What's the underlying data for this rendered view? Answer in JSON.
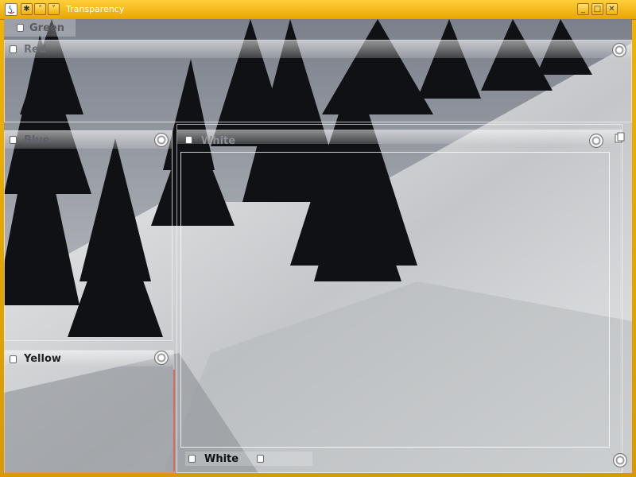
{
  "window": {
    "title": "Transparency",
    "title_icon": "java-icon",
    "menu_icons": [
      "sun-icon",
      "chevron-up-icon",
      "chevron-down-icon"
    ],
    "controls": [
      "minimize-icon",
      "maximize-icon",
      "close-icon"
    ]
  },
  "panels": [
    {
      "id": "green",
      "label": "Green"
    },
    {
      "id": "red",
      "label": "Red"
    },
    {
      "id": "blue",
      "label": "Blue"
    },
    {
      "id": "white",
      "label": "White"
    },
    {
      "id": "yellow",
      "label": "Yellow"
    },
    {
      "id": "white-bottom",
      "label": "White"
    }
  ],
  "colors": {
    "window_frame": "#e6a400",
    "title_text": "#ffffff"
  }
}
